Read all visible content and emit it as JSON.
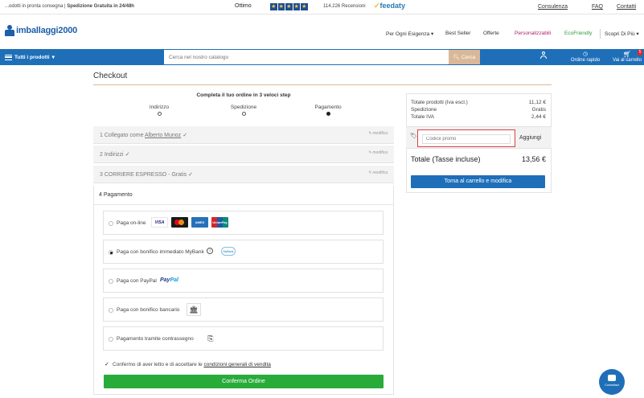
{
  "topbar": {
    "promo_text": "...odotti in pronta consegna | ",
    "promo_bold": "Spedizione Gratuita in 24/48h",
    "rating_label": "Ottimo",
    "reviews": "114.226 Recensioni",
    "feedaty": "feedaty",
    "links": [
      "Consulenza",
      "FAQ",
      "Contatti"
    ]
  },
  "header": {
    "logo": "imballaggi2000",
    "nav": [
      "Per Ogni Esigenza",
      "Best Seller",
      "Offerte",
      "Personalizzabili",
      "EcoFriendly",
      "Scopri Di Più"
    ]
  },
  "bluebar": {
    "all_products": "Tutti i prodotti",
    "search_placeholder": "Cerca nel nostro catalogo",
    "search_button": "Cerca",
    "quick_order": "Ordine rapido",
    "cart": "Vai al carrello",
    "cart_count": "5"
  },
  "checkout": {
    "title": "Checkout",
    "steps_heading": "Completa il tuo ordine in 3 veloci step",
    "steps": [
      "Indirizzo",
      "Spedizione",
      "Pagamento"
    ],
    "sections": [
      {
        "label": "1 Collegato come",
        "user": "Alberto Munoz",
        "edit": "modifica"
      },
      {
        "label": "2 Indirizzi",
        "edit": "modifica"
      },
      {
        "label": "3 CORRIERE ESPRESSO - Gratis",
        "edit": "modifica"
      }
    ],
    "payment_title": "4 Pagamento",
    "payment_options": [
      "Paga on-line",
      "Paga con bonifico immediato MyBank",
      "Paga con PayPal",
      "Paga con bonifico bancario",
      "Pagamento tramite contrassegno"
    ],
    "card_labels": {
      "visa": "VISA",
      "amex": "AMEX",
      "union": "UnionPay",
      "mybank": "MyBank"
    },
    "paypal_a": "Pay",
    "paypal_b": "Pal",
    "agree_text": "Confermo di aver letto e di accettare le ",
    "agree_link": "condizioni generali di vendita",
    "confirm_button": "Conferma Ordine"
  },
  "summary": {
    "rows": [
      {
        "label": "Totale prodotti (Iva escl.)",
        "value": "11,12 €"
      },
      {
        "label": "Spedizione",
        "value": "Gratis"
      },
      {
        "label": "Totale IVA",
        "value": "2,44 €"
      }
    ],
    "promo_placeholder": "Codice promo",
    "add_button": "Aggiungi",
    "total_label": "Totale (Tasse incluse)",
    "total_value": "13,56 €",
    "back_button": "Torna al carrello e modifica"
  },
  "chat": {
    "label": "Contattaci"
  },
  "colors": {
    "brand_blue": "#1e6fb8",
    "confirm_green": "#29ab3a",
    "accent_tan": "#d9b899"
  }
}
